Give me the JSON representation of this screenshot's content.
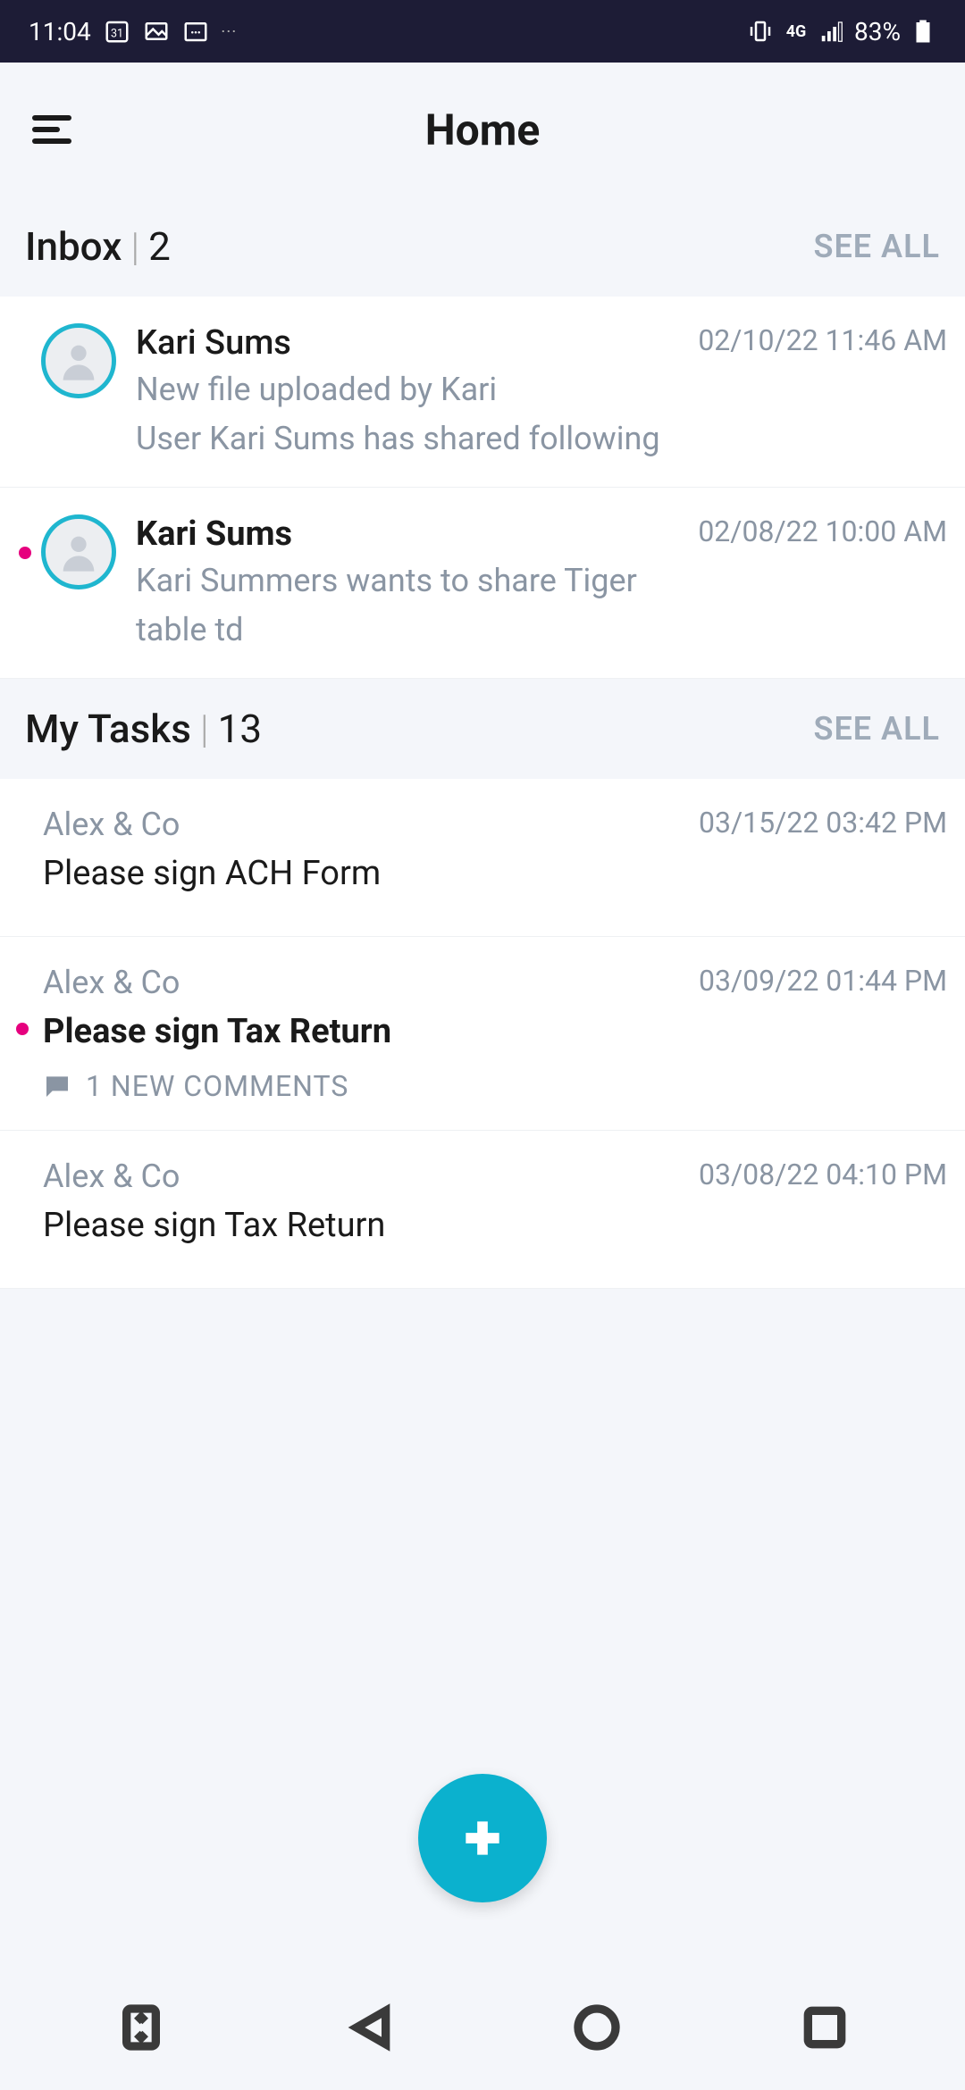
{
  "status": {
    "time": "11:04",
    "battery": "83%"
  },
  "header": {
    "title": "Home"
  },
  "inbox": {
    "label": "Inbox",
    "count": "2",
    "see_all": "SEE ALL",
    "items": [
      {
        "name": "Kari Sums",
        "time": "02/10/22 11:46 AM",
        "line1": "New file uploaded by Kari",
        "line2": "User Kari Sums has shared following",
        "unread": false
      },
      {
        "name": "Kari Sums",
        "time": "02/08/22 10:00 AM",
        "line1": "Kari Summers wants to share Tiger",
        "line2": "table td",
        "unread": true
      }
    ]
  },
  "tasks": {
    "label": "My Tasks",
    "count": "13",
    "see_all": "SEE ALL",
    "items": [
      {
        "client": "Alex & Co",
        "time": "03/15/22 03:42 PM",
        "title": "Please sign ACH Form",
        "unread": false,
        "comments": null
      },
      {
        "client": "Alex & Co",
        "time": "03/09/22 01:44 PM",
        "title": "Please sign Tax Return",
        "unread": true,
        "comments": "1 NEW COMMENTS"
      },
      {
        "client": "Alex & Co",
        "time": "03/08/22 04:10 PM",
        "title": "Please sign Tax Return",
        "unread": false,
        "comments": null
      }
    ]
  }
}
